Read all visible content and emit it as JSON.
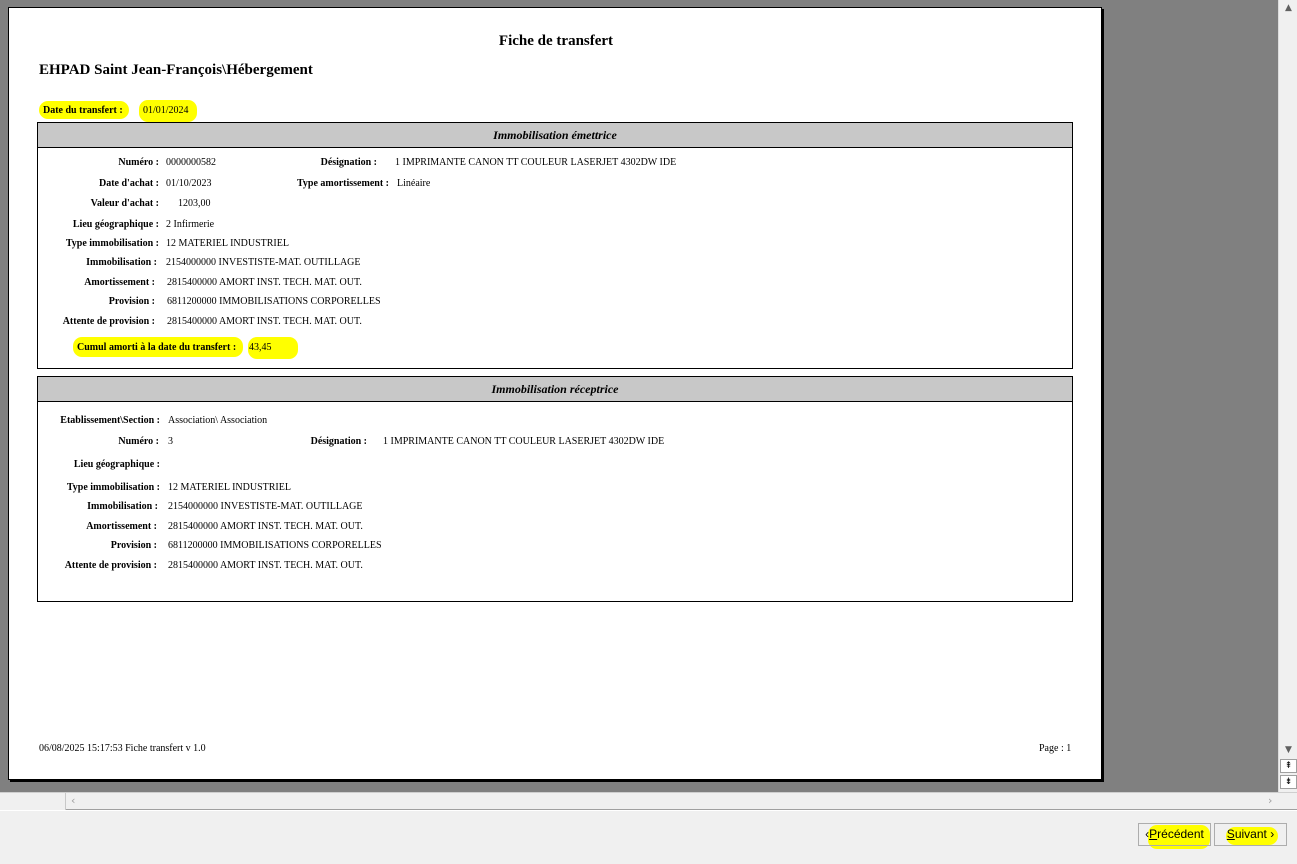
{
  "report": {
    "title": "Fiche de transfert",
    "establishment": "EHPAD Saint Jean-François\\Hébergement",
    "transfer_date_label": "Date du transfert :",
    "transfer_date": "01/01/2024"
  },
  "emitting": {
    "header": "Immobilisation émettrice",
    "fields": {
      "numero_label": "Numéro :",
      "numero": "0000000582",
      "designation_label": "Désignation :",
      "designation": "1 IMPRIMANTE CANON TT COULEUR LASERJET 4302DW IDE",
      "date_achat_label": "Date d'achat :",
      "date_achat": "01/10/2023",
      "type_amort_label": "Type amortissement :",
      "type_amort": "Linéaire",
      "valeur_achat_label": "Valeur d'achat :",
      "valeur_achat": "1203,00",
      "lieu_label": "Lieu géographique :",
      "lieu": "2 Infirmerie",
      "type_immo_label": "Type immobilisation :",
      "type_immo": "12 MATERIEL INDUSTRIEL",
      "immo_label": "Immobilisation :",
      "immo": "2154000000 INVESTISTE-MAT. OUTILLAGE",
      "amort_label": "Amortissement :",
      "amort": "2815400000 AMORT INST. TECH. MAT. OUT.",
      "provision_label": "Provision :",
      "provision": "6811200000 IMMOBILISATIONS CORPORELLES",
      "attente_label": "Attente de provision :",
      "attente": "2815400000 AMORT INST. TECH. MAT. OUT.",
      "cumul_label": "Cumul amorti à la date du transfert :",
      "cumul": "43,45"
    }
  },
  "receiving": {
    "header": "Immobilisation réceptrice",
    "fields": {
      "etab_label": "Etablissement\\Section :",
      "etab": "Association\\ Association",
      "numero_label": "Numéro :",
      "numero": "3",
      "designation_label": "Désignation :",
      "designation": "1 IMPRIMANTE CANON TT COULEUR LASERJET 4302DW IDE",
      "lieu_label": "Lieu géographique :",
      "type_immo_label": "Type immobilisation :",
      "type_immo": "12 MATERIEL INDUSTRIEL",
      "immo_label": "Immobilisation :",
      "immo": "2154000000 INVESTISTE-MAT. OUTILLAGE",
      "amort_label": "Amortissement :",
      "amort": "2815400000 AMORT INST. TECH. MAT. OUT.",
      "provision_label": "Provision :",
      "provision": "6811200000 IMMOBILISATIONS CORPORELLES",
      "attente_label": "Attente de provision :",
      "attente": "2815400000 AMORT INST. TECH. MAT. OUT."
    }
  },
  "footer": {
    "timestamp": "06/08/2025  15:17:53 Fiche transfert v 1.0",
    "page": "Page : 1"
  },
  "buttons": {
    "prev_arrow": "‹",
    "prev_hot": "P",
    "prev_rest": "récédent",
    "next_hot": "S",
    "next_rest": "uivant",
    "next_arrow": "›"
  },
  "scrollbar_icons": [
    "scroll-up-icon",
    "scroll-down-icon",
    "page-up-icon",
    "page-down-icon",
    "scroll-left-icon",
    "scroll-right-icon"
  ],
  "highlight_color": "#ffff00"
}
